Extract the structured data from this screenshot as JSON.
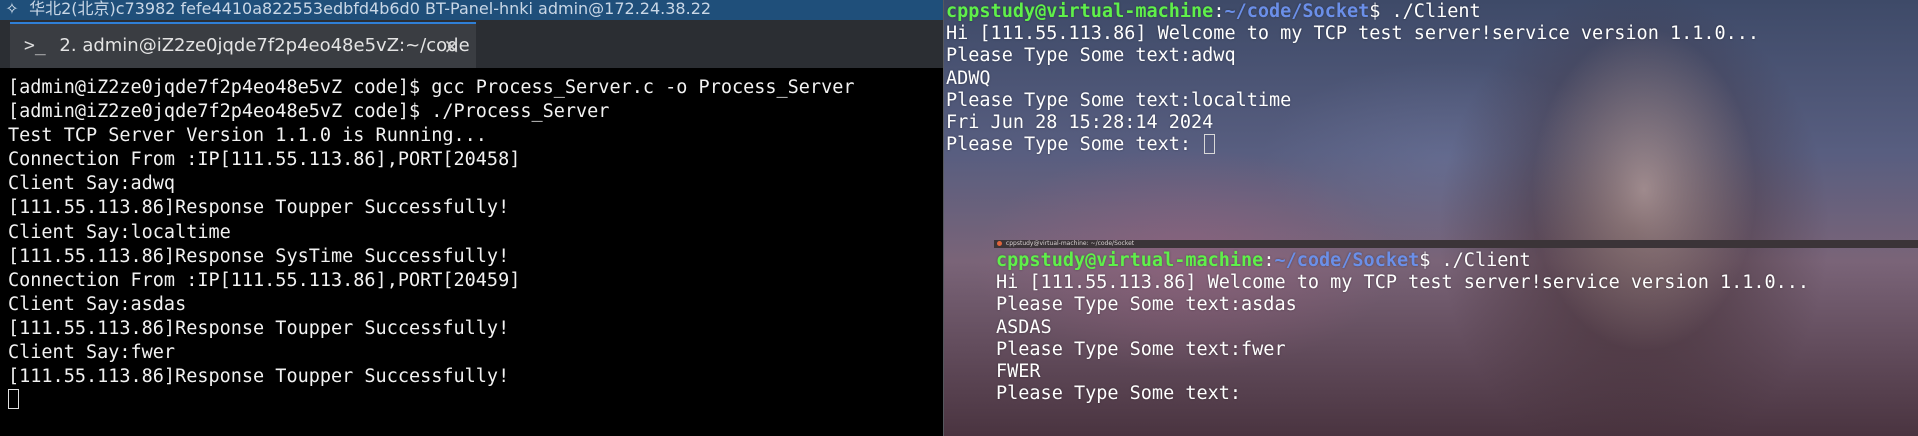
{
  "left_window": {
    "title": "华北2(北京)c73982 fefe4410a822553edbfd4b6d0   BT-Panel-hnki   admin@172.24.38.22",
    "tab": {
      "label": "2. admin@iZ2ze0jqde7f2p4eo48e5vZ:~/code",
      "icon": "terminal-prompt-icon",
      "close": "×"
    },
    "terminal_lines": [
      "[admin@iZ2ze0jqde7f2p4eo48e5vZ code]$ gcc Process_Server.c -o Process_Server",
      "[admin@iZ2ze0jqde7f2p4eo48e5vZ code]$ ./Process_Server",
      "Test TCP Server Version 1.1.0 is Running...",
      "Connection From :IP[111.55.113.86],PORT[20458]",
      "Client Say:adwq",
      "[111.55.113.86]Response Toupper Successfully!",
      "Client Say:localtime",
      "[111.55.113.86]Response SysTime Successfully!",
      "Connection From :IP[111.55.113.86],PORT[20459]",
      "Client Say:asdas",
      "[111.55.113.86]Response Toupper Successfully!",
      "Client Say:fwer",
      "[111.55.113.86]Response Toupper Successfully!"
    ]
  },
  "right_terminal_1": {
    "user_host": "cppstudy@virtual-machine",
    "path": "~/code/Socket",
    "command": "$ ./Client",
    "lines": [
      "Hi [111.55.113.86] Welcome to my TCP test server!service version 1.1.0...",
      "Please Type Some text:adwq",
      "ADWQ",
      "Please Type Some text:localtime",
      "Fri Jun 28 15:28:14 2024",
      "Please Type Some text: "
    ]
  },
  "right_terminal_2": {
    "title": "cppstudy@virtual-machine: ~/code/Socket",
    "user_host": "cppstudy@virtual-machine",
    "path": "~/code/Socket",
    "command": "$ ./Client",
    "lines": [
      "Hi [111.55.113.86] Welcome to my TCP test server!service version 1.1.0...",
      "Please Type Some text:asdas",
      "ASDAS",
      "Please Type Some text:fwer",
      "FWER",
      "Please Type Some text:"
    ]
  },
  "colors": {
    "user_host_green": "#5ff04a",
    "path_blue": "#6b8fe8",
    "tab_accent": "#2f7fd6"
  }
}
